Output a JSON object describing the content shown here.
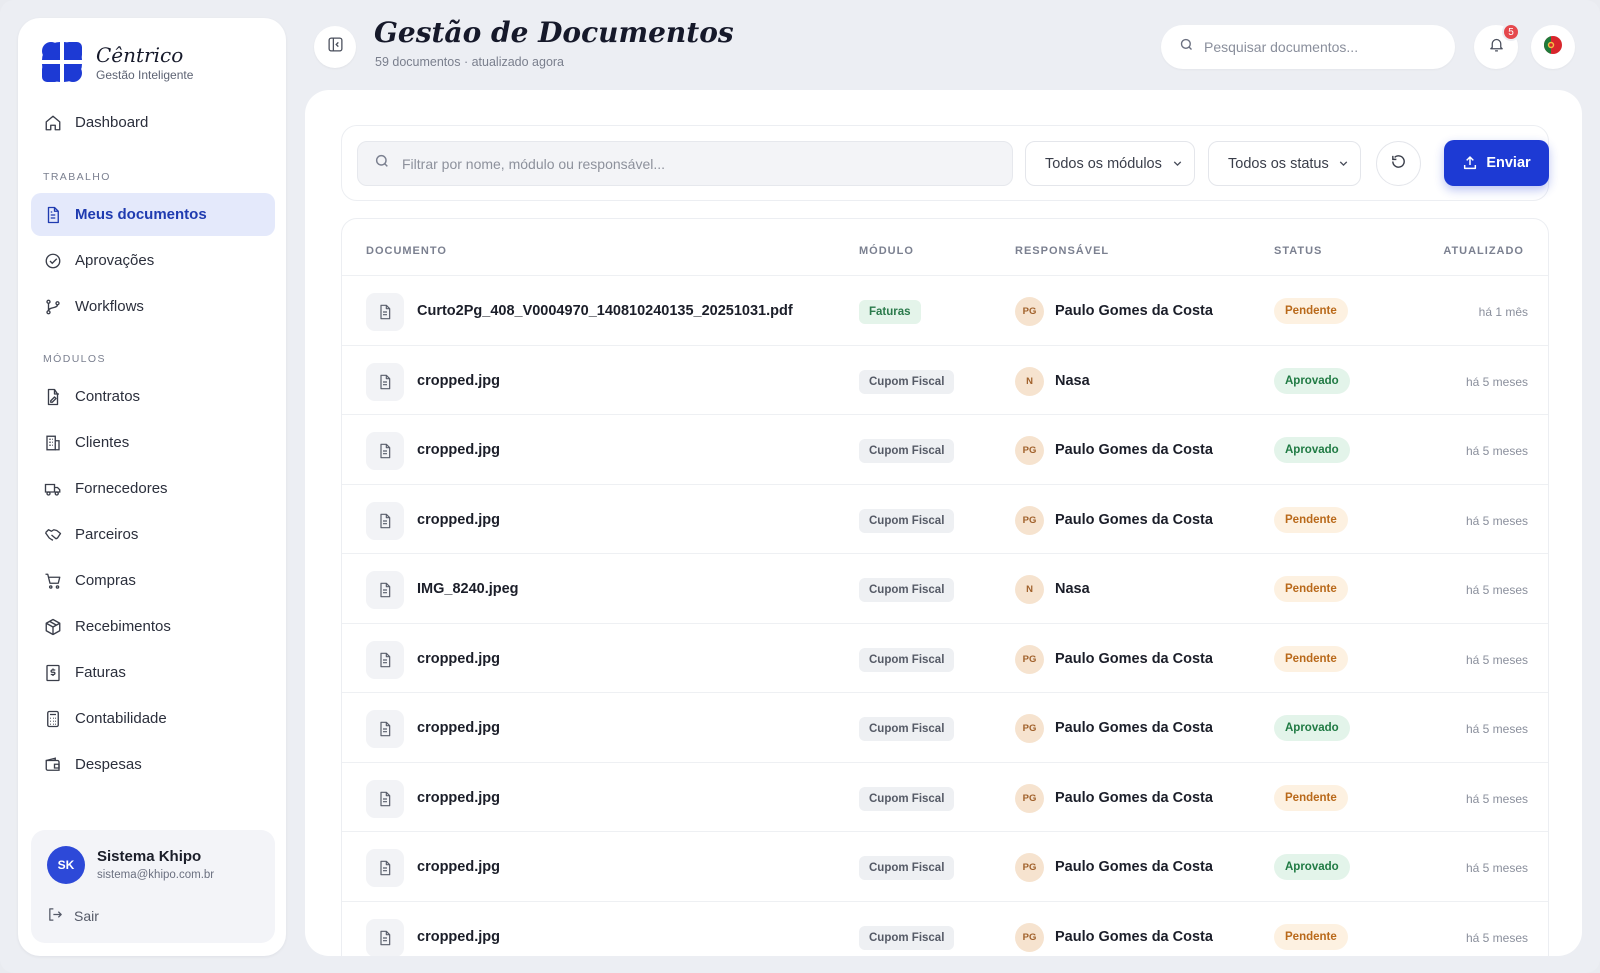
{
  "brand": {
    "name": "Cêntrico",
    "subtitle": "Gestão Inteligente",
    "color": "#1d3ad4"
  },
  "nav": {
    "dashboard": "Dashboard",
    "section_trabalho": "TRABALHO",
    "trabalho": [
      {
        "label": "Meus documentos",
        "icon": "file-text-icon",
        "active": true
      },
      {
        "label": "Aprovações",
        "icon": "check-circle-icon"
      },
      {
        "label": "Workflows",
        "icon": "git-branch-icon"
      }
    ],
    "section_modulos": "MÓDULOS",
    "modulos": [
      {
        "label": "Contratos",
        "icon": "file-signature-icon"
      },
      {
        "label": "Clientes",
        "icon": "building-icon"
      },
      {
        "label": "Fornecedores",
        "icon": "truck-icon"
      },
      {
        "label": "Parceiros",
        "icon": "handshake-icon"
      },
      {
        "label": "Compras",
        "icon": "cart-icon"
      },
      {
        "label": "Recebimentos",
        "icon": "package-icon"
      },
      {
        "label": "Faturas",
        "icon": "receipt-icon"
      },
      {
        "label": "Contabilidade",
        "icon": "calculator-icon"
      },
      {
        "label": "Despesas",
        "icon": "wallet-icon"
      }
    ]
  },
  "user": {
    "initials": "SK",
    "name": "Sistema Khipo",
    "email": "sistema@khipo.com.br",
    "logout": "Sair"
  },
  "header": {
    "title": "Gestão de Documentos",
    "subtitle": "59 documentos · atualizado agora",
    "search_placeholder": "Pesquisar documentos...",
    "notifications": "5"
  },
  "filters": {
    "placeholder": "Filtrar por nome, módulo ou responsável...",
    "module_select": "Todos os módulos",
    "status_select": "Todos os status",
    "send_label": "Enviar"
  },
  "table": {
    "columns": [
      "DOCUMENTO",
      "MÓDULO",
      "RESPONSÁVEL",
      "STATUS",
      "ATUALIZADO"
    ],
    "rows": [
      {
        "name": "Curto2Pg_408_V0004970_140810240135_20251031.pdf",
        "module": "Faturas",
        "initials": "PG",
        "responsible": "Paulo Gomes da Costa",
        "status": "Pendente",
        "updated": "há 1 mês"
      },
      {
        "name": "cropped.jpg",
        "module": "Cupom Fiscal",
        "initials": "N",
        "responsible": "Nasa",
        "status": "Aprovado",
        "updated": "há 5 meses"
      },
      {
        "name": "cropped.jpg",
        "module": "Cupom Fiscal",
        "initials": "PG",
        "responsible": "Paulo Gomes da Costa",
        "status": "Aprovado",
        "updated": "há 5 meses"
      },
      {
        "name": "cropped.jpg",
        "module": "Cupom Fiscal",
        "initials": "PG",
        "responsible": "Paulo Gomes da Costa",
        "status": "Pendente",
        "updated": "há 5 meses"
      },
      {
        "name": "IMG_8240.jpeg",
        "module": "Cupom Fiscal",
        "initials": "N",
        "responsible": "Nasa",
        "status": "Pendente",
        "updated": "há 5 meses"
      },
      {
        "name": "cropped.jpg",
        "module": "Cupom Fiscal",
        "initials": "PG",
        "responsible": "Paulo Gomes da Costa",
        "status": "Pendente",
        "updated": "há 5 meses"
      },
      {
        "name": "cropped.jpg",
        "module": "Cupom Fiscal",
        "initials": "PG",
        "responsible": "Paulo Gomes da Costa",
        "status": "Aprovado",
        "updated": "há 5 meses"
      },
      {
        "name": "cropped.jpg",
        "module": "Cupom Fiscal",
        "initials": "PG",
        "responsible": "Paulo Gomes da Costa",
        "status": "Pendente",
        "updated": "há 5 meses"
      },
      {
        "name": "cropped.jpg",
        "module": "Cupom Fiscal",
        "initials": "PG",
        "responsible": "Paulo Gomes da Costa",
        "status": "Aprovado",
        "updated": "há 5 meses"
      },
      {
        "name": "cropped.jpg",
        "module": "Cupom Fiscal",
        "initials": "PG",
        "responsible": "Paulo Gomes da Costa",
        "status": "Pendente",
        "updated": "há 5 meses"
      }
    ]
  },
  "colors": {
    "accent": "#1d3ad4",
    "pending_bg": "#fdf1e1",
    "pending_fg": "#b9691a",
    "approved_bg": "#e3f4ea",
    "approved_fg": "#1f7a43",
    "faturas_bg": "#e4f4ea",
    "faturas_fg": "#2a7a4b",
    "cupom_bg": "#eef0f3",
    "cupom_fg": "#555a66"
  }
}
